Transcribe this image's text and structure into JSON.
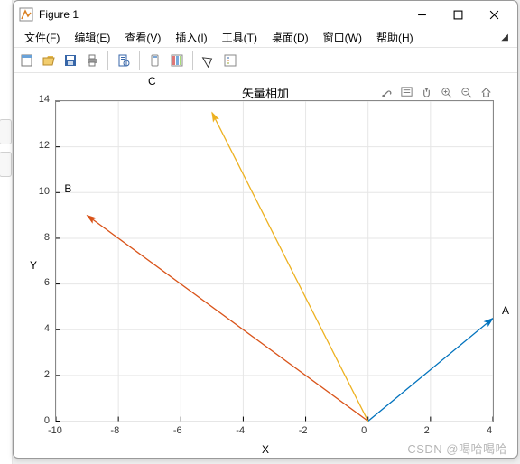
{
  "window": {
    "title": "Figure 1",
    "min_tooltip": "Minimize",
    "max_tooltip": "Maximize",
    "close_tooltip": "Close"
  },
  "menus": {
    "file": "文件(F)",
    "edit": "编辑(E)",
    "view": "查看(V)",
    "insert": "插入(I)",
    "tools": "工具(T)",
    "desktop": "桌面(D)",
    "window_m": "窗口(W)",
    "help": "帮助(H)"
  },
  "plot": {
    "title": "矢量相加",
    "letter_c": "C",
    "xlabel": "X",
    "ylabel": "Y"
  },
  "annotations": {
    "A": "A",
    "B": "B"
  },
  "watermark": "CSDN @喝哈喝哈",
  "chart_data": {
    "type": "line",
    "title": "矢量相加",
    "xlabel": "X",
    "ylabel": "Y",
    "xlim": [
      -10,
      4
    ],
    "ylim": [
      0,
      14
    ],
    "xticks": [
      -10,
      -8,
      -6,
      -4,
      -2,
      0,
      2,
      4
    ],
    "yticks": [
      0,
      2,
      4,
      6,
      8,
      10,
      12,
      14
    ],
    "series": [
      {
        "name": "A",
        "color": "#0072BD",
        "arrow": true,
        "x": [
          0,
          4
        ],
        "y": [
          0,
          4.5
        ]
      },
      {
        "name": "B",
        "color": "#D95319",
        "arrow": true,
        "x": [
          0,
          -9
        ],
        "y": [
          0,
          9
        ]
      },
      {
        "name": "C",
        "color": "#EDB120",
        "arrow": true,
        "x": [
          0,
          -5
        ],
        "y": [
          0,
          13.5
        ]
      }
    ],
    "annotations": [
      {
        "text": "A",
        "x": 4.2,
        "y": 4.8
      },
      {
        "text": "B",
        "x": -9.7,
        "y": 10.1
      },
      {
        "text": "C",
        "x": -5,
        "y": 14.3
      }
    ]
  }
}
